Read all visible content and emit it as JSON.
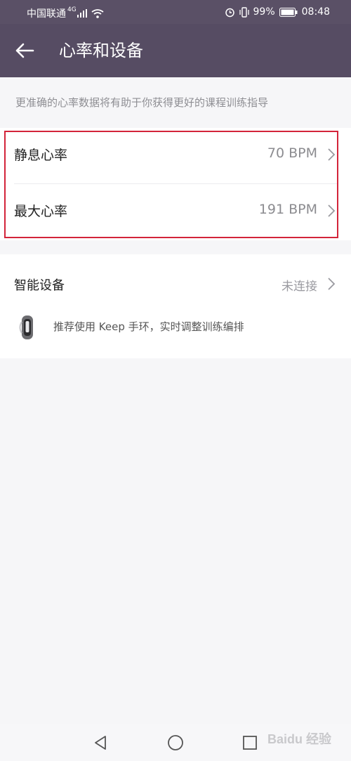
{
  "status_bar": {
    "carrier": "中国联通",
    "network": "4G",
    "battery": "99%",
    "time": "08:48"
  },
  "header": {
    "title": "心率和设备"
  },
  "hint": "更准确的心率数据将有助于你获得更好的课程训练指导",
  "heart_rate": [
    {
      "label": "静息心率",
      "value": "70 BPM"
    },
    {
      "label": "最大心率",
      "value": "191 BPM"
    }
  ],
  "devices": {
    "label": "智能设备",
    "status": "未连接",
    "recommendation": "推荐使用 Keep 手环，实时调整训练编排"
  },
  "watermark": "Baidu 经验",
  "colors": {
    "appbar": "#564c63",
    "highlight": "#d3243a"
  }
}
